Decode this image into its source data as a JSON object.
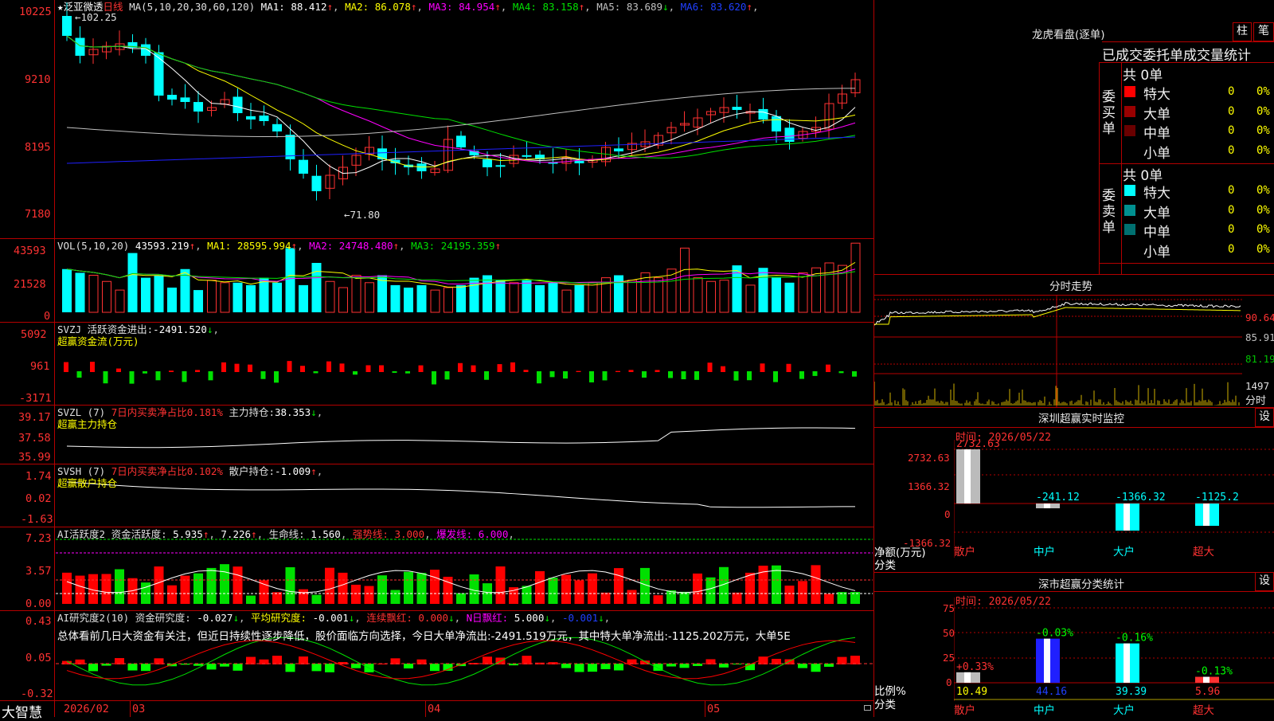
{
  "stock": {
    "star": "★",
    "name": "泛亚微透",
    "period": "日线",
    "ma_label": "MA(5,10,20,30,60,120)",
    "ma": [
      {
        "k": "MA1:",
        "v": "88.412",
        "a": "↑",
        "c": "#ffffff"
      },
      {
        "k": "MA2:",
        "v": "86.078",
        "a": "↑",
        "c": "#ffff00"
      },
      {
        "k": "MA3:",
        "v": "84.954",
        "a": "↑",
        "c": "#ff00ff"
      },
      {
        "k": "MA4:",
        "v": "83.158",
        "a": "↑",
        "c": "#00e000"
      },
      {
        "k": "MA5:",
        "v": "83.689",
        "a": "↓",
        "c": "#c0c0c0"
      },
      {
        "k": "MA6:",
        "v": "83.620",
        "a": "↑",
        "c": "#2040ff"
      }
    ],
    "high_mark": "←102.25",
    "low_mark": "←71.80"
  },
  "axes": {
    "price": [
      "10225",
      "9210",
      "8195",
      "7180"
    ],
    "vol": [
      "43593",
      "21528",
      "0"
    ],
    "svzj": [
      "5092",
      "961",
      "-3171"
    ],
    "svzl": [
      "39.17",
      "37.58",
      "35.99"
    ],
    "svsh": [
      "1.74",
      "0.02",
      "-1.63"
    ],
    "ai1": [
      "7.23",
      "3.57",
      "0.00"
    ],
    "ai2": [
      "0.43",
      "0.05",
      "-0.32"
    ]
  },
  "vol": {
    "label": "VOL(5,10,20)",
    "v": "43593.219",
    "a": "↑",
    "m": [
      {
        "k": "MA1:",
        "v": "28595.994",
        "a": "↑",
        "c": "#ffff00"
      },
      {
        "k": "MA2:",
        "v": "24748.480",
        "a": "↑",
        "c": "#ff00ff"
      },
      {
        "k": "MA3:",
        "v": "24195.359",
        "a": "↑",
        "c": "#00e000"
      }
    ]
  },
  "svzj": {
    "label": "SVZJ",
    "k": "活跃资金进出:",
    "v": "-2491.520",
    "a": "↓",
    "sub": "超赢资金流(万元)"
  },
  "svzl": {
    "label": "SVZL (7)",
    "r": "7日内买卖净占比0.181%",
    "k": "主力持仓:",
    "v": "38.353",
    "a": "↓",
    "sub": "超赢主力持仓"
  },
  "svsh": {
    "label": "SVSH (7)",
    "r": "7日内买卖净占比0.102%",
    "k": "散户持仓:",
    "v": "-1.009",
    "a": "↑",
    "sub": "超赢散户持仓"
  },
  "ai1": {
    "label": "AI活跃度2",
    "k": "资金活跃度:",
    "v1": "5.935",
    "a1": "↑",
    "v2": "7.226",
    "a2": "↑",
    "k2": "生命线:",
    "v3": "1.560",
    "k3": "强势线:",
    "v4": "3.000",
    "k4": "爆发线:",
    "v5": "6.000"
  },
  "ai2": {
    "label": "AI研究度2(10)",
    "k": "资金研究度:",
    "v": "-0.027",
    "a": "↓",
    "k2": "平均研究度:",
    "v2": "-0.001",
    "a2": "↓",
    "k3": "连续飘红:",
    "v3": "0.000",
    "a3": "↓",
    "k4": "N日飘红:",
    "v4": "5.000",
    "a4": "↓",
    "v5": "-0.001",
    "a5": "↓",
    "summary": "总体看前几日大资金有关注，但近日持续性逐步降低，股价面临方向选择，今日大单净流出:-2491.519万元，其中特大单净流出:-1125.202万元，大单5E"
  },
  "bottom": {
    "brand": "大智慧",
    "dates": [
      "2026/02",
      "03",
      "04",
      "05"
    ]
  },
  "dragon": {
    "title": "龙虎看盘(逐单)",
    "btn1": "柱",
    "btn2": "笔",
    "headers": "已成交委托单成交量统计",
    "buy": {
      "side": "委买单",
      "total": "共 0单",
      "rows": [
        {
          "n": "特大",
          "v": "0",
          "p": "0%",
          "c": "#ff0000"
        },
        {
          "n": "大单",
          "v": "0",
          "p": "0%",
          "c": "#9a0000"
        },
        {
          "n": "中单",
          "v": "0",
          "p": "0%",
          "c": "#6a0000"
        },
        {
          "n": "小单",
          "v": "0",
          "p": "0%",
          "c": "#000000"
        }
      ]
    },
    "sell": {
      "side": "委卖单",
      "total": "共 0单",
      "rows": [
        {
          "n": "特大",
          "v": "0",
          "p": "0%",
          "c": "#00ffff"
        },
        {
          "n": "大单",
          "v": "0",
          "p": "0%",
          "c": "#009090"
        },
        {
          "n": "中单",
          "v": "0",
          "p": "0%",
          "c": "#007070"
        },
        {
          "n": "小单",
          "v": "0",
          "p": "0%",
          "c": "#000000"
        }
      ]
    }
  },
  "fenshi": {
    "title": "分时走势",
    "y": [
      "90.64",
      "85.91",
      "81.19",
      "1497"
    ],
    "unit": "分时"
  },
  "monitor": {
    "title": "深圳超赢实时监控",
    "btn": "设",
    "time": "时间: 2026/05/22",
    "y": [
      "2732.63",
      "1366.32",
      "0",
      "-1366.32"
    ],
    "ylab": "净额(万元)",
    "xlab": "分类",
    "cats": [
      "散户",
      "中户",
      "大户",
      "超大"
    ],
    "vals": [
      "2732.63",
      "-241.12",
      "-1366.32",
      "-1125.2"
    ]
  },
  "classify": {
    "title": "深市超赢分类统计",
    "btn": "设",
    "time": "时间: 2026/05/22",
    "y": [
      "75",
      "50",
      "25",
      "0"
    ],
    "ylab": "比例%",
    "xlab": "分类",
    "cats": [
      "散户",
      "中户",
      "大户",
      "超大"
    ],
    "vals": [
      "10.49",
      "44.16",
      "39.39",
      "5.96"
    ],
    "chg": [
      "+0.33%",
      "-0.03%",
      "-0.16%",
      "-0.13%"
    ]
  },
  "chart_data": {
    "type": "candlestick",
    "title": "泛亚微透 日线",
    "ylim": [
      71.8,
      102.25
    ],
    "high": "102.25",
    "low": "71.80"
  }
}
